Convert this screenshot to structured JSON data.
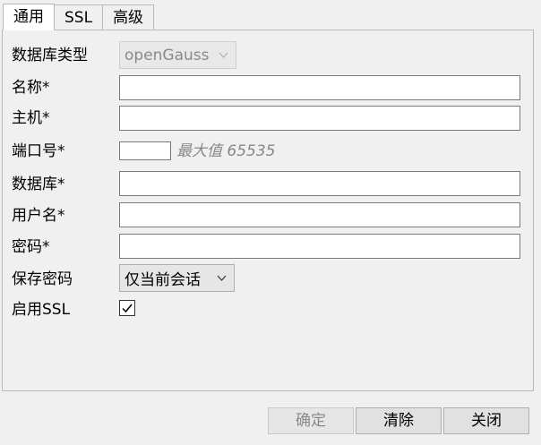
{
  "tabs": [
    {
      "label": "通用",
      "active": true
    },
    {
      "label": "SSL",
      "active": false
    },
    {
      "label": "高级",
      "active": false
    }
  ],
  "form": {
    "db_type": {
      "label": "数据库类型",
      "value": "openGauss",
      "disabled": true
    },
    "name": {
      "label": "名称*",
      "value": ""
    },
    "host": {
      "label": "主机*",
      "value": ""
    },
    "port": {
      "label": "端口号*",
      "value": "",
      "hint": "最大值 65535"
    },
    "database": {
      "label": "数据库*",
      "value": ""
    },
    "username": {
      "label": "用户名*",
      "value": ""
    },
    "password": {
      "label": "密码*",
      "value": ""
    },
    "save_password": {
      "label": "保存密码",
      "value": "仅当前会话"
    },
    "ssl": {
      "label": "启用SSL",
      "checked": true
    }
  },
  "buttons": {
    "confirm": "确定",
    "clear": "清除",
    "close": "关闭"
  }
}
